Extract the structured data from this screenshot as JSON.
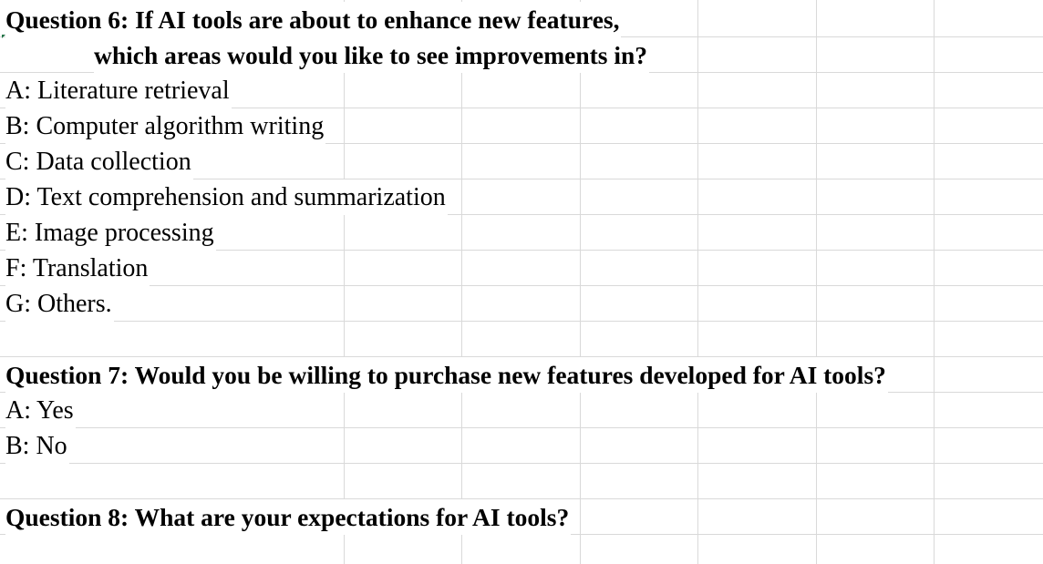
{
  "sheet": {
    "rows": [
      {
        "text": "Question 6: If AI tools are about to enhance new features,",
        "bold": true,
        "indent": false
      },
      {
        "text": "which areas would you like to see improvements in?",
        "bold": true,
        "indent": true
      },
      {
        "text": "A: Literature retrieval",
        "bold": false,
        "indent": false
      },
      {
        "text": "B: Computer algorithm writing",
        "bold": false,
        "indent": false
      },
      {
        "text": "C: Data collection",
        "bold": false,
        "indent": false
      },
      {
        "text": "D: Text comprehension and summarization",
        "bold": false,
        "indent": false
      },
      {
        "text": "E: Image processing",
        "bold": false,
        "indent": false
      },
      {
        "text": "F: Translation",
        "bold": false,
        "indent": false
      },
      {
        "text": "G: Others.",
        "bold": false,
        "indent": false
      },
      {
        "text": "",
        "bold": false,
        "indent": false
      },
      {
        "text": "Question 7: Would you be willing to purchase new features developed for AI tools?",
        "bold": true,
        "indent": false
      },
      {
        "text": "A: Yes",
        "bold": false,
        "indent": false
      },
      {
        "text": "B: No",
        "bold": false,
        "indent": false
      },
      {
        "text": "",
        "bold": false,
        "indent": false
      },
      {
        "text": "Question 8: What are your expectations for AI tools?",
        "bold": true,
        "indent": false
      },
      {
        "text": "",
        "bold": false,
        "indent": false
      }
    ],
    "gridline_color": "#d9d9d9",
    "selection_color": "#217346"
  }
}
